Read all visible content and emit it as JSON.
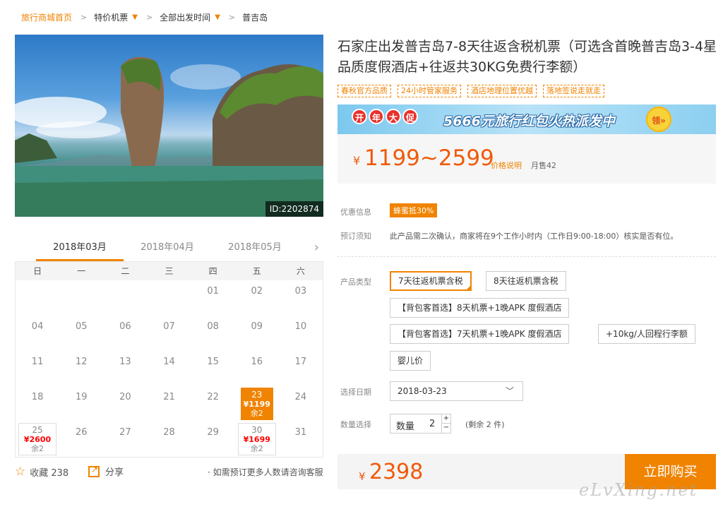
{
  "breadcrumb": {
    "home": "旅行商城首页",
    "b2": "特价机票",
    "b3": "全部出发时间",
    "b4": "普吉岛"
  },
  "hero": {
    "id_badge": "ID:2202874"
  },
  "calendar": {
    "months": [
      "2018年03月",
      "2018年04月",
      "2018年05月"
    ],
    "weekdays": [
      "日",
      "一",
      "二",
      "三",
      "四",
      "五",
      "六"
    ],
    "selected": {
      "day": "23",
      "price": "¥1199",
      "remain": "余2"
    },
    "d25": {
      "day": "25",
      "price": "¥2600",
      "remain": "余2"
    },
    "d30": {
      "day": "30",
      "price": "¥1699",
      "remain": "余2"
    }
  },
  "actions": {
    "favorite": "收藏 238",
    "share": "分享",
    "more": "· 如需预订更多人数请咨询客服"
  },
  "product": {
    "title": "石家庄出发普吉岛7-8天往返含税机票（可选含首晚普吉岛3-4星品质度假酒店+往返共30KG免费行李额）",
    "tags": [
      "春秋官方品质",
      "24小时管家服务",
      "酒店地理位置优越",
      "落地签说走就走"
    ],
    "promo": {
      "b1": "开",
      "b2": "年",
      "b3": "大",
      "b4": "促",
      "text": "5666元旅行红包火热派发中",
      "ling": "领»"
    },
    "price": {
      "yen": "¥",
      "range": "1199~2599",
      "note": "价格说明",
      "sold": "月售42"
    },
    "labels": {
      "discount": "优惠信息",
      "notice": "预订须知",
      "type": "产品类型",
      "date": "选择日期",
      "qty": "数量选择"
    },
    "discount": "蜂蜜抵30%",
    "notice": "此产品需二次确认，商家将在9个工作小时内（工作日9:00-18:00）核实是否有位。",
    "options": [
      "7天往返机票含税",
      "8天往返机票含税",
      "【背包客首选】8天机票+1晚APK 度假酒店",
      "【背包客首选】7天机票+1晚APK 度假酒店",
      "+10kg/人回程行李额",
      "婴儿价"
    ],
    "date_value": "2018-03-23",
    "qty_label": "数量",
    "qty_value": "2",
    "remain": "(剩余 2 件)",
    "total_yen": "¥",
    "total": "2398",
    "buy": "立即购买"
  },
  "watermark": "eLvXing.net"
}
